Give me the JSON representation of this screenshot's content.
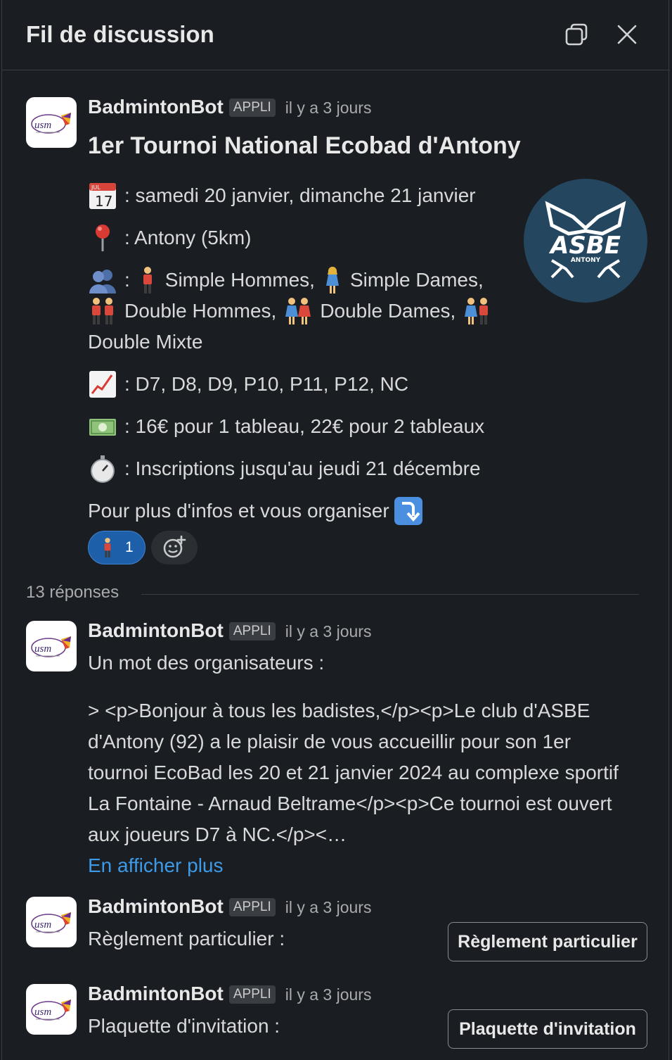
{
  "header": {
    "title": "Fil de discussion"
  },
  "messages": [
    {
      "author": "BadmintonBot",
      "badge": "APPLI",
      "time": "il y a 3 jours",
      "title": "1er Tournoi National Ecobad d'Antony",
      "lines": [
        ": samedi 20 janvier, dimanche 21 janvier",
        ": Antony (5km)",
        ": ",
        "Simple Hommes,",
        "Simple Dames,",
        "Double Hommes,",
        "Double Dames,",
        "Double Mixte",
        ": D7, D8, D9, P10, P11, P12, NC",
        ": 16€ pour 1 tableau, 22€ pour 2 tableaux",
        ": Inscriptions jusqu'au jeudi 21 décembre",
        "Pour plus d'infos et vous organiser"
      ],
      "calendar_month": "JUL",
      "calendar_day": "17",
      "asbe_logo": "ASBE",
      "asbe_sub": "ANTONY",
      "reaction_count": "1"
    },
    {
      "author": "BadmintonBot",
      "badge": "APPLI",
      "time": "il y a 3 jours",
      "text": "Un mot des organisateurs :",
      "quote": "> <p>Bonjour à tous les badistes,</p><p>Le club d'ASBE d'Antony (92) a le plaisir de vous accueillir pour son 1er tournoi EcoBad les 20 et 21 janvier 2024 au complexe sportif La Fontaine - Arnaud Beltrame</p><p>Ce tournoi est ouvert aux joueurs D7 à NC.</p><…",
      "more": "En afficher plus"
    },
    {
      "author": "BadmintonBot",
      "badge": "APPLI",
      "time": "il y a 3 jours",
      "text": "Règlement particulier :",
      "button": "Règlement particulier"
    },
    {
      "author": "BadmintonBot",
      "badge": "APPLI",
      "time": "il y a 3 jours",
      "text": "Plaquette d'invitation :",
      "button": "Plaquette d'invitation"
    }
  ],
  "replies": "13 réponses",
  "avatar_text": "usm"
}
